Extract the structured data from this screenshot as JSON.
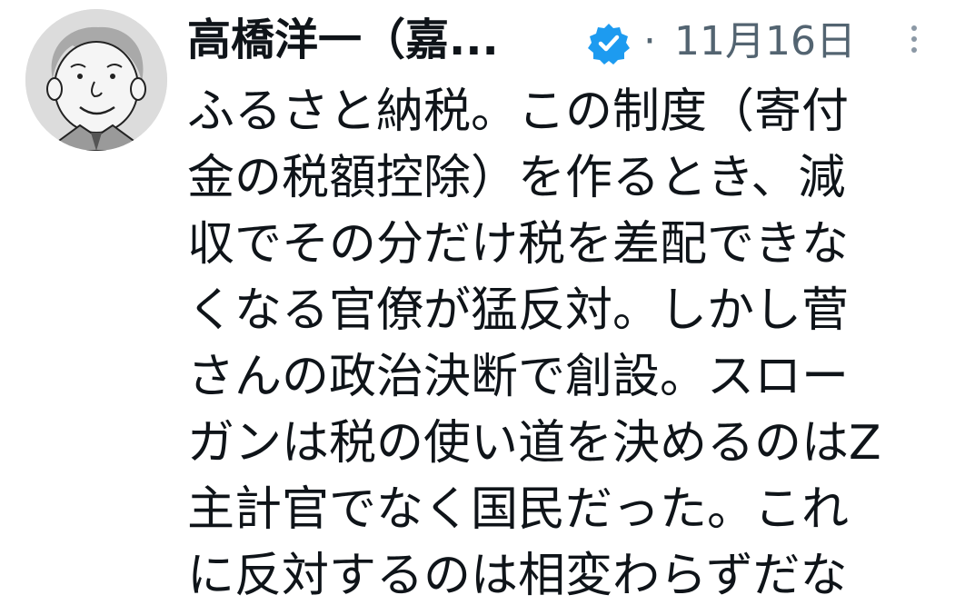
{
  "author": {
    "display_name": "高橋洋一（嘉...",
    "verified_icon": "verified-badge-icon",
    "avatar_icon": "cartoon-avatar",
    "brand_color": "#1d9bf0"
  },
  "meta": {
    "separator": "·",
    "date": "11月16日",
    "more_icon": "more-vertical-icon"
  },
  "tweet": {
    "lines": [
      "ふるさと納税。この制度（寄付",
      "金の税額控除）を作るとき、減",
      "収でその分だけ税を差配できな",
      "くなる官僚が猛反対。しかし菅",
      "さんの政治決断で創設。スロー",
      "ガンは税の使い道を決めるのはZ",
      "主計官でなく国民だった。これ",
      "に反対するのは相変わらずだな"
    ]
  }
}
